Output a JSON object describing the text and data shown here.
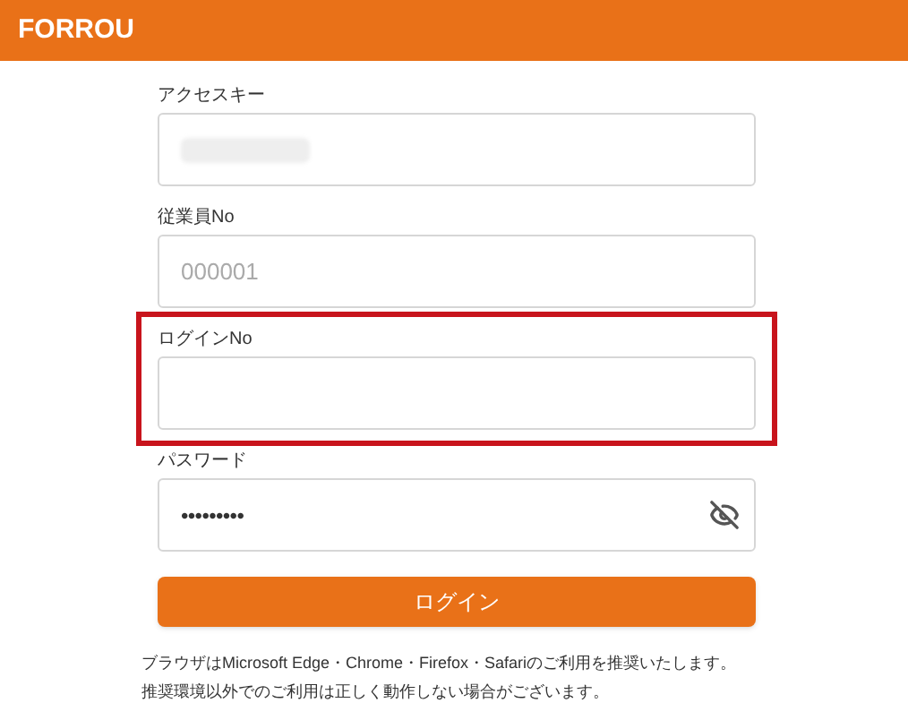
{
  "header": {
    "title": "FORROU"
  },
  "fields": [
    {
      "label": "アクセスキー",
      "kind": "blurred",
      "highlighted": false
    },
    {
      "label": "従業員No",
      "kind": "text",
      "placeholder": "000001",
      "highlighted": false
    },
    {
      "label": "ログインNo",
      "kind": "text",
      "highlighted": true
    },
    {
      "label": "パスワード",
      "kind": "password",
      "value": "•••••••••",
      "highlighted": false
    }
  ],
  "login_button": "ログイン",
  "notes": [
    "ブラウザはMicrosoft Edge・Chrome・Firefox・Safariのご利用を推奨いたします。",
    "推奨環境以外でのご利用は正しく動作しない場合がございます。"
  ]
}
